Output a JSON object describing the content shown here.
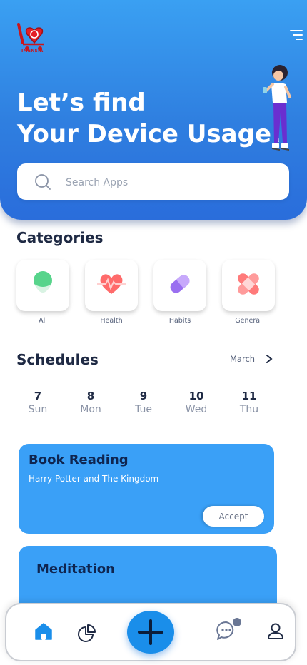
{
  "brand": {
    "logo_text": "IMENSIA"
  },
  "hero": {
    "title_line1": "Let’s find",
    "title_line2": "Your Device Usage!"
  },
  "search": {
    "placeholder": "Search Apps"
  },
  "categories": {
    "title": "Categories",
    "items": [
      {
        "label": "All",
        "icon": "all-icon"
      },
      {
        "label": "Health",
        "icon": "heart-pulse-icon"
      },
      {
        "label": "Habits",
        "icon": "pill-icon"
      },
      {
        "label": "General",
        "icon": "bandage-icon"
      }
    ]
  },
  "schedules": {
    "title": "Schedules",
    "month": "March",
    "days": [
      {
        "num": "7",
        "name": "Sun"
      },
      {
        "num": "8",
        "name": "Mon"
      },
      {
        "num": "9",
        "name": "Tue"
      },
      {
        "num": "10",
        "name": "Wed"
      },
      {
        "num": "11",
        "name": "Thu"
      }
    ]
  },
  "cards": [
    {
      "title": "Book Reading",
      "subtitle": "Harry Potter and The Kingdom",
      "button": "Accept"
    },
    {
      "title": "Meditation"
    }
  ],
  "nav": {
    "items": [
      "home-icon",
      "chart-icon",
      "add-icon",
      "chat-icon",
      "profile-icon"
    ]
  },
  "colors": {
    "primary": "#2f7fe0",
    "card": "#3aa0f7",
    "fab": "#1a8eea",
    "text": "#1f2a44"
  }
}
